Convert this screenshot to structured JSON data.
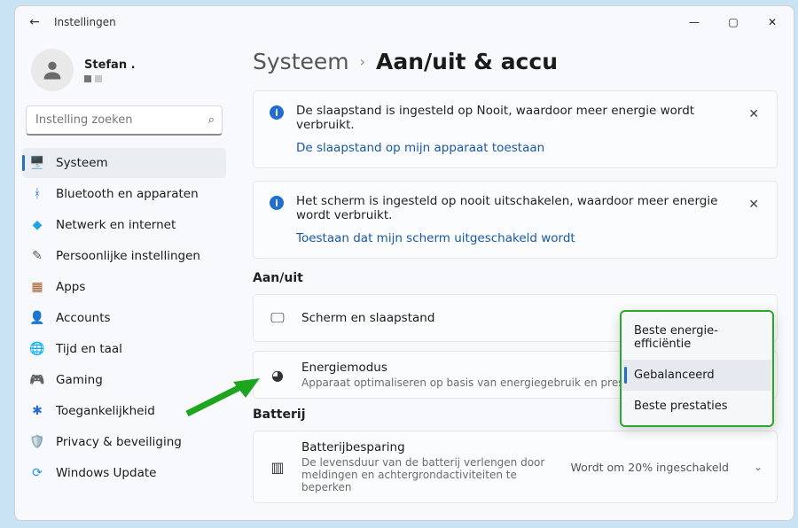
{
  "window": {
    "back_icon": "←",
    "title": "Instellingen",
    "min": "—",
    "max": "▢",
    "close": "✕"
  },
  "user": {
    "name": "Stefan ."
  },
  "search": {
    "placeholder": "Instelling zoeken"
  },
  "sidebar": {
    "items": [
      {
        "label": "Systeem",
        "icon": "🖥️",
        "selected": true
      },
      {
        "label": "Bluetooth en apparaten",
        "icon": "ᚼ",
        "color": "#1f6ed4"
      },
      {
        "label": "Netwerk en internet",
        "icon": "◆",
        "color": "#1fa4e5"
      },
      {
        "label": "Persoonlijke instellingen",
        "icon": "✎",
        "color": "#5a5a5a"
      },
      {
        "label": "Apps",
        "icon": "▦",
        "color": "#a25b2a"
      },
      {
        "label": "Accounts",
        "icon": "👤",
        "color": "#2e9a3a"
      },
      {
        "label": "Tijd en taal",
        "icon": "🌐",
        "color": "#c97a12"
      },
      {
        "label": "Gaming",
        "icon": "🎮",
        "color": "#8a1234"
      },
      {
        "label": "Toegankelijkheid",
        "icon": "✱",
        "color": "#1f6ed4"
      },
      {
        "label": "Privacy & beveiliging",
        "icon": "🛡️",
        "color": "#7a7a7a"
      },
      {
        "label": "Windows Update",
        "icon": "⟳",
        "color": "#1f8fe5"
      }
    ]
  },
  "breadcrumb": {
    "parent": "Systeem",
    "chev": "›",
    "current": "Aan/uit & accu"
  },
  "notices": [
    {
      "msg": "De slaapstand is ingesteld op Nooit, waardoor meer energie wordt verbruikt.",
      "link": "De slaapstand op mijn apparaat toestaan"
    },
    {
      "msg": "Het scherm is ingesteld op nooit uitschakelen, waardoor meer energie wordt verbruikt.",
      "link": "Toestaan dat mijn scherm uitgeschakeld wordt"
    }
  ],
  "sections": {
    "power": {
      "title": "Aan/uit",
      "rows": [
        {
          "title": "Scherm en slaapstand"
        },
        {
          "title": "Energiemodus",
          "sub": "Apparaat optimaliseren op basis van energiegebruik en prestaties"
        }
      ]
    },
    "battery": {
      "title": "Batterij",
      "rows": [
        {
          "title": "Batterijbesparing",
          "sub": "De levensduur van de batterij verlengen door meldingen en achtergrondactiviteiten te beperken",
          "right": "Wordt om 20% ingeschakeld"
        }
      ]
    }
  },
  "dropdown": {
    "items": [
      {
        "label": "Beste energie-efficiëntie"
      },
      {
        "label": "Gebalanceerd",
        "selected": true
      },
      {
        "label": "Beste prestaties"
      }
    ]
  },
  "icons": {
    "info": "i",
    "close": "✕",
    "search": "⌕",
    "chev_down": "⌄"
  }
}
